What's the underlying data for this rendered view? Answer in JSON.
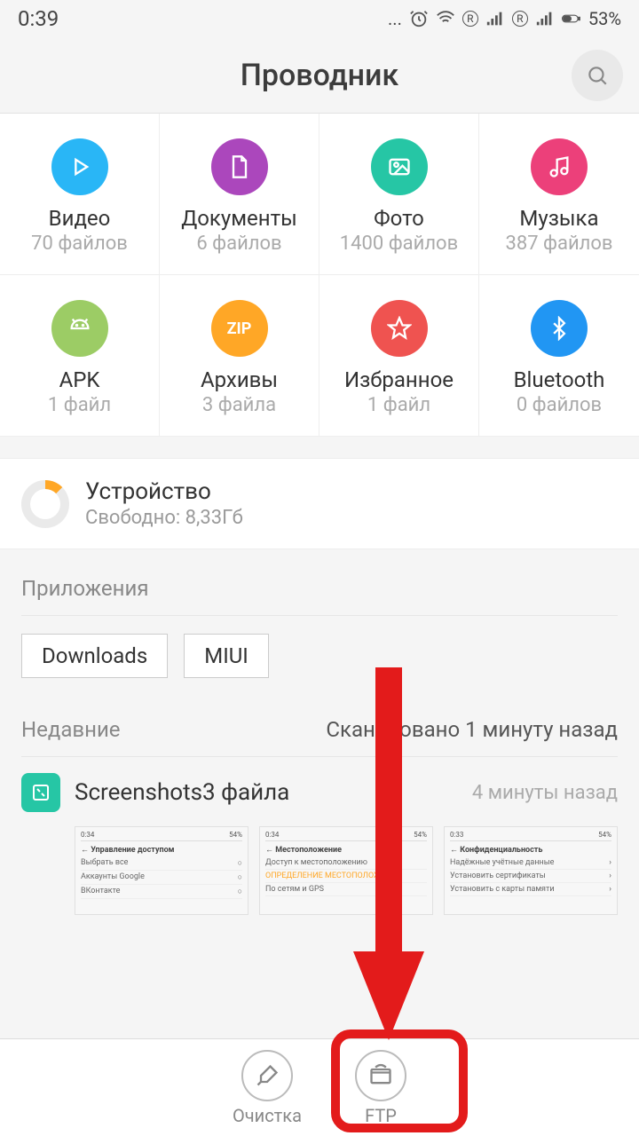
{
  "status": {
    "time": "0:39",
    "battery": "53%"
  },
  "header": {
    "title": "Проводник"
  },
  "categories": [
    {
      "key": "video",
      "label": "Видео",
      "sub": "70 файлов",
      "color": "#29b6f6"
    },
    {
      "key": "docs",
      "label": "Документы",
      "sub": "6 файлов",
      "color": "#ab47bc"
    },
    {
      "key": "photo",
      "label": "Фото",
      "sub": "1400 файлов",
      "color": "#26c6a5"
    },
    {
      "key": "music",
      "label": "Музыка",
      "sub": "387 файлов",
      "color": "#ec407a"
    },
    {
      "key": "apk",
      "label": "APK",
      "sub": "1 файл",
      "color": "#9ccc65"
    },
    {
      "key": "archive",
      "label": "Архивы",
      "sub": "3 файла",
      "color": "#ffa726"
    },
    {
      "key": "fav",
      "label": "Избранное",
      "sub": "1 файл",
      "color": "#ef5350"
    },
    {
      "key": "bt",
      "label": "Bluetooth",
      "sub": "0 файлов",
      "color": "#2196f3"
    }
  ],
  "storage": {
    "title": "Устройство",
    "sub": "Свободно: 8,33Гб"
  },
  "apps": {
    "heading": "Приложения",
    "chips": [
      "Downloads",
      "MIUI"
    ]
  },
  "recent": {
    "heading": "Недавние",
    "scan": "Сканировано 1 минуту назад",
    "folder": "Screenshots",
    "count": "3 файла",
    "time": "4 минуты назад",
    "thumb_titles": [
      "Управление доступом",
      "Местоположение",
      "Конфиденциальность"
    ]
  },
  "bottom": {
    "clean": "Очистка",
    "ftp": "FTP"
  }
}
